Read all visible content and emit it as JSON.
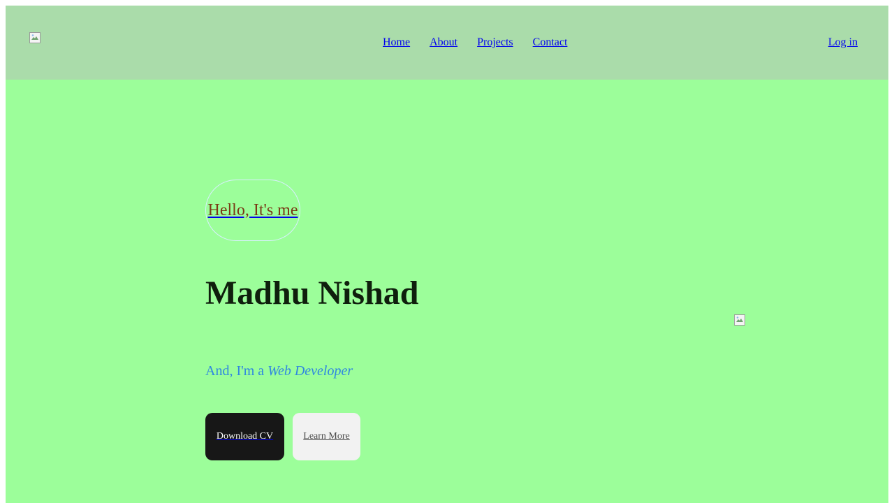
{
  "nav": {
    "logo_icon": "broken-image-icon",
    "links": [
      "Home",
      "About",
      "Projects",
      "Contact"
    ],
    "login": "Log in"
  },
  "hero": {
    "greeting": "Hello, It's me",
    "name": "Madhu Nishad",
    "role_prefix": "And, I'm a ",
    "role_highlight": "Web Developer",
    "download_button": "Download CV",
    "learn_button": "Learn More",
    "image_icon": "broken-image-icon"
  },
  "colors": {
    "page_background": "#9cfe9a",
    "header_background": "#aadcaa",
    "greeting_text": "#7a3a16",
    "name_text": "#0f1f0d",
    "role_text": "#2f87e0",
    "link": "#0000ee",
    "primary_button": "#171717",
    "secondary_button": "#f2f2f2"
  }
}
